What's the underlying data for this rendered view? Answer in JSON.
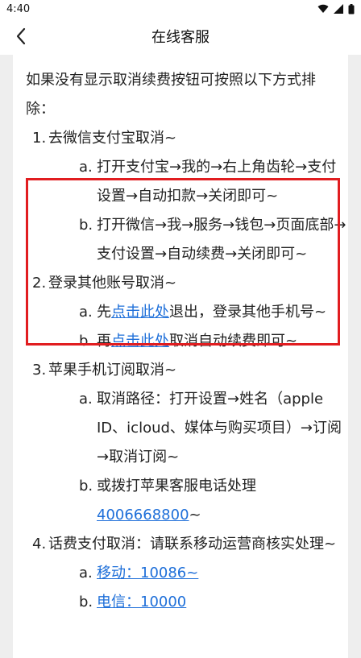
{
  "status": {
    "time": "4:40"
  },
  "header": {
    "title": "在线客服"
  },
  "content": {
    "intro": "如果没有显示取消续费按钮可按照以下方式排除：",
    "sections": [
      {
        "num": "1.",
        "text": "去微信支付宝取消~",
        "items": [
          {
            "label": "a.",
            "text": "打开支付宝→我的→右上角齿轮→支付设置→自动扣款→关闭即可~"
          },
          {
            "label": "b.",
            "text": "打开微信→我→服务→钱包→页面底部→支付设置→自动续费→关闭即可~"
          }
        ]
      },
      {
        "num": "2.",
        "text": "登录其他账号取消~",
        "items": [
          {
            "label": "a.",
            "before": "先",
            "link": "点击此处",
            "after": "退出，登录其他手机号~"
          },
          {
            "label": "b.",
            "before": "再",
            "link": "点击此处",
            "after": "取消自动续费即可~"
          }
        ]
      },
      {
        "num": "3.",
        "text": "苹果手机订阅取消~",
        "items": [
          {
            "label": "a.",
            "text": "取消路径：打开设置→姓名（apple ID、icloud、媒体与购买项目）→订阅→取消订阅~"
          },
          {
            "label": "b.",
            "text": "或拨打苹果客服电话处理",
            "phone": "4006668800",
            "phone_suffix": "~"
          }
        ]
      },
      {
        "num": "4.",
        "text": "话费支付取消：请联系移动运营商核实处理~",
        "items": [
          {
            "label": "a.",
            "link": "移动：10086~"
          },
          {
            "label": "b.",
            "link": "电信：10000"
          }
        ]
      }
    ]
  },
  "colors": {
    "highlight": "#e11d20",
    "link": "#1e6fd9",
    "background": "#eeeeee"
  }
}
